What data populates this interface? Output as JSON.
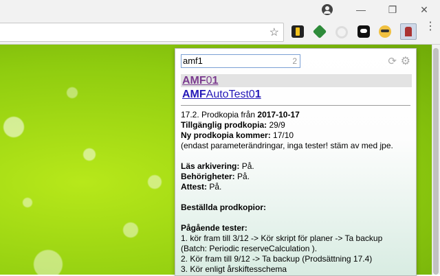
{
  "titlebar": {
    "min": "—",
    "restore": "❐",
    "close": "✕"
  },
  "toolbar": {
    "star": "☆",
    "menu": "⋮"
  },
  "popup": {
    "search": {
      "value": "amf1",
      "count": "2"
    },
    "results": [
      {
        "bold": "AMF",
        "rest": "0",
        "tail": "1"
      },
      {
        "bold": "AMF",
        "rest": "AutoTest0",
        "tail": "1"
      }
    ],
    "info": {
      "line1_pre": "17.2. Prodkopia från ",
      "line1_date": "2017-10-17",
      "l2_label": "Tillgänglig prodkopia:",
      "l2_value": " 29/9",
      "l3_label": "Ny prodkopia kommer:",
      "l3_value": " 17/10",
      "l4": "(endast parameterändringar, inga tester! stäm av med jpe.",
      "l5_label": "Läs arkivering:",
      "l5_value": " På.",
      "l6_label": "Behörigheter:",
      "l6_value": " På.",
      "l7_label": "Attest:",
      "l7_value": " På.",
      "l8_label": "Beställda prodkopior:",
      "l9_label": "Pågående tester:",
      "l10": "1. kör fram till 3/12 -> Kör skript för planer -> Ta backup",
      "l11": "(Batch: Periodic reserveCalculation ).",
      "l12": "2. Kör fram till 9/12 -> Ta backup (Prodsättning 17.4)",
      "l13": "3. Kör enligt årskiftesschema"
    }
  }
}
